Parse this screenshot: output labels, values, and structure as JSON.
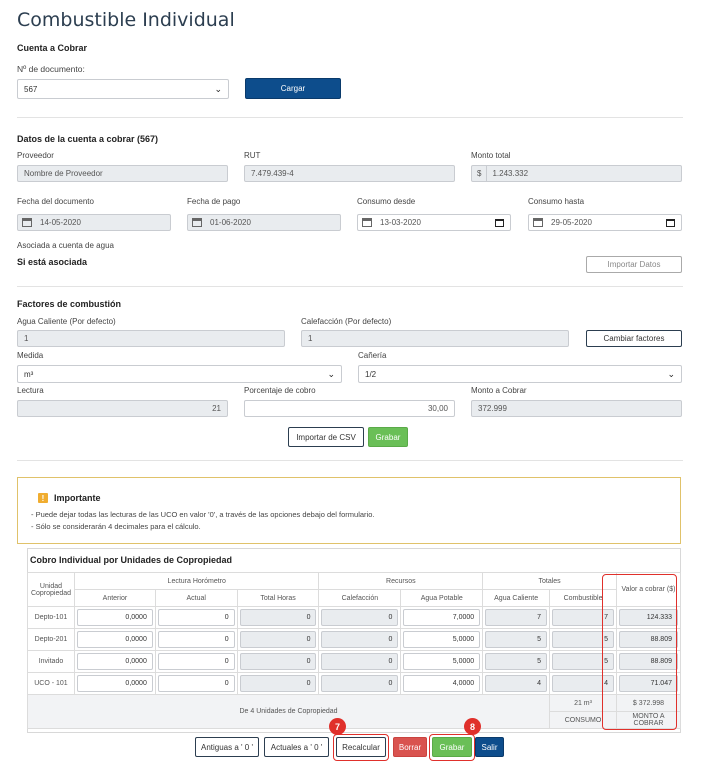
{
  "page": {
    "title": "Combustible Individual"
  },
  "cuenta": {
    "section_title": "Cuenta a Cobrar",
    "doc_label": "Nº de documento:",
    "doc_value": "567",
    "cargar_label": "Cargar"
  },
  "datos": {
    "section_title": "Datos de la cuenta a cobrar (567)",
    "proveedor_label": "Proveedor",
    "proveedor_value": "Nombre de Proveedor",
    "rut_label": "RUT",
    "rut_value": "7.479.439-4",
    "monto_label": "Monto total",
    "monto_currency": "$",
    "monto_value": "1.243.332",
    "fecha_doc_label": "Fecha del documento",
    "fecha_doc_value": "14-05-2020",
    "fecha_pago_label": "Fecha de pago",
    "fecha_pago_value": "01-06-2020",
    "consumo_desde_label": "Consumo desde",
    "consumo_desde_value": "13-03-2020",
    "consumo_hasta_label": "Consumo hasta",
    "consumo_hasta_value": "29-05-2020",
    "asociada_label": "Asociada a cuenta de agua",
    "asociada_value": "Si está asociada",
    "importar_datos_label": "Importar Datos"
  },
  "factores": {
    "section_title": "Factores de combustión",
    "agua_label": "Agua Caliente (Por defecto)",
    "agua_value": "1",
    "calef_label": "Calefacción (Por defecto)",
    "calef_value": "1",
    "cambiar_label": "Cambiar factores",
    "medida_label": "Medida",
    "medida_value": "m³",
    "caneria_label": "Cañería",
    "caneria_value": "1/2",
    "lectura_label": "Lectura",
    "lectura_value": "21",
    "porcentaje_label": "Porcentaje de cobro",
    "porcentaje_value": "30,00",
    "monto_cobrar_label": "Monto a Cobrar",
    "monto_cobrar_value": "372.999",
    "importar_csv_label": "Importar de CSV",
    "grabar_label": "Grabar"
  },
  "alert": {
    "title": "Importante",
    "icon": "!",
    "line1": "- Puede dejar todas las lecturas de las UCO en valor '0', a través de las opciones debajo del formulario.",
    "line2": "- Sólo se considerarán 4 decimales para el cálculo."
  },
  "tabla": {
    "title": "Cobro Individual por Unidades de Copropiedad",
    "col_unidad": "Unidad Copropiedad",
    "group_lectura": "Lectura Horómetro",
    "group_recursos": "Recursos",
    "group_totales": "Totales",
    "col_valor": "Valor a cobrar ($)",
    "col_anterior": "Anterior",
    "col_actual": "Actual",
    "col_total_horas": "Total Horas",
    "col_calefaccion": "Calefacción",
    "col_agua_potable": "Agua Potable",
    "col_agua_caliente": "Agua Caliente",
    "col_combustible": "Combustible",
    "rows": [
      {
        "unidad": "Depto-101",
        "anterior": "0,0000",
        "actual": "0",
        "total_horas": "0",
        "calefaccion": "0",
        "agua_potable": "7,0000",
        "agua_caliente": "7",
        "combustible": "7",
        "valor": "124.333"
      },
      {
        "unidad": "Depto-201",
        "anterior": "0,0000",
        "actual": "0",
        "total_horas": "0",
        "calefaccion": "0",
        "agua_potable": "5,0000",
        "agua_caliente": "5",
        "combustible": "5",
        "valor": "88.809"
      },
      {
        "unidad": "Invitado",
        "anterior": "0,0000",
        "actual": "0",
        "total_horas": "0",
        "calefaccion": "0",
        "agua_potable": "5,0000",
        "agua_caliente": "5",
        "combustible": "5",
        "valor": "88.809"
      },
      {
        "unidad": "UCO - 101",
        "anterior": "0,0000",
        "actual": "0",
        "total_horas": "0",
        "calefaccion": "0",
        "agua_potable": "4,0000",
        "agua_caliente": "4",
        "combustible": "4",
        "valor": "71.047"
      }
    ],
    "footer_count": "De 4 Unidades de Copropiedad",
    "footer_consumo_value": "21 m³",
    "footer_consumo_label": "CONSUMO",
    "footer_monto_value": "$ 372.998",
    "footer_monto_label": "MONTO A COBRAR"
  },
  "actions": {
    "antiguas": "Antiguas a ' 0 '",
    "actuales": "Actuales a ' 0 '",
    "recalcular": "Recalcular",
    "borrar": "Borrar",
    "grabar": "Grabar",
    "salir": "Salir"
  },
  "callouts": {
    "seven": "7",
    "eight": "8"
  },
  "colors": {
    "primary": "#0d4d8c",
    "success": "#6abf57",
    "danger": "#d9534f",
    "callout": "#e0302b",
    "warning": "#f0ad30"
  }
}
